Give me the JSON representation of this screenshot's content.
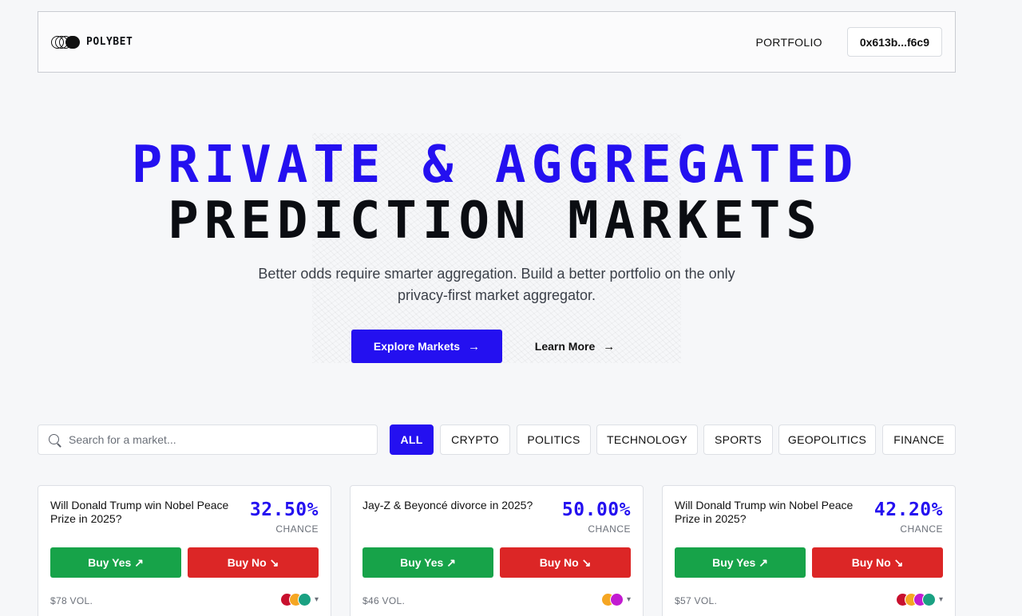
{
  "brand": {
    "name": "POLYBET"
  },
  "nav": {
    "portfolio": "PORTFOLIO",
    "wallet": "0x613b...f6c9"
  },
  "hero": {
    "line1": "PRIVATE & AGGREGATED",
    "line2": "PREDICTION MARKETS",
    "subtitle_1": "Better odds require smarter aggregation. Build a better portfolio on the only",
    "subtitle_2": "privacy-first market aggregator.",
    "explore_label": "Explore Markets",
    "learn_label": "Learn More",
    "arrow": "→"
  },
  "search": {
    "placeholder": "Search for a market..."
  },
  "categories": [
    "ALL",
    "CRYPTO",
    "POLITICS",
    "TECHNOLOGY",
    "SPORTS",
    "GEOPOLITICS",
    "FINANCE"
  ],
  "active_category": "ALL",
  "cards": [
    {
      "question": "Will Donald Trump win Nobel Peace Prize in 2025?",
      "percent": "32.50%",
      "chance_label": "CHANCE",
      "yes_label": "Buy Yes ↗",
      "no_label": "Buy No ↘",
      "volume": "$78 VOL.",
      "sources": [
        "#c8102e",
        "#f5a623",
        "#1aa182"
      ]
    },
    {
      "question": "Jay-Z & Beyoncé divorce in 2025?",
      "percent": "50.00%",
      "chance_label": "CHANCE",
      "yes_label": "Buy Yes ↗",
      "no_label": "Buy No ↘",
      "volume": "$46 VOL.",
      "sources": [
        "#f5a623",
        "#c21bd1"
      ]
    },
    {
      "question": "Will Donald Trump win Nobel Peace Prize in 2025?",
      "percent": "42.20%",
      "chance_label": "CHANCE",
      "yes_label": "Buy Yes ↗",
      "no_label": "Buy No ↘",
      "volume": "$57 VOL.",
      "sources": [
        "#c8102e",
        "#f5a623",
        "#c21bd1",
        "#1aa182"
      ]
    }
  ],
  "colors": {
    "accent": "#2410f0",
    "yes": "#17a349",
    "no": "#dc2626"
  }
}
